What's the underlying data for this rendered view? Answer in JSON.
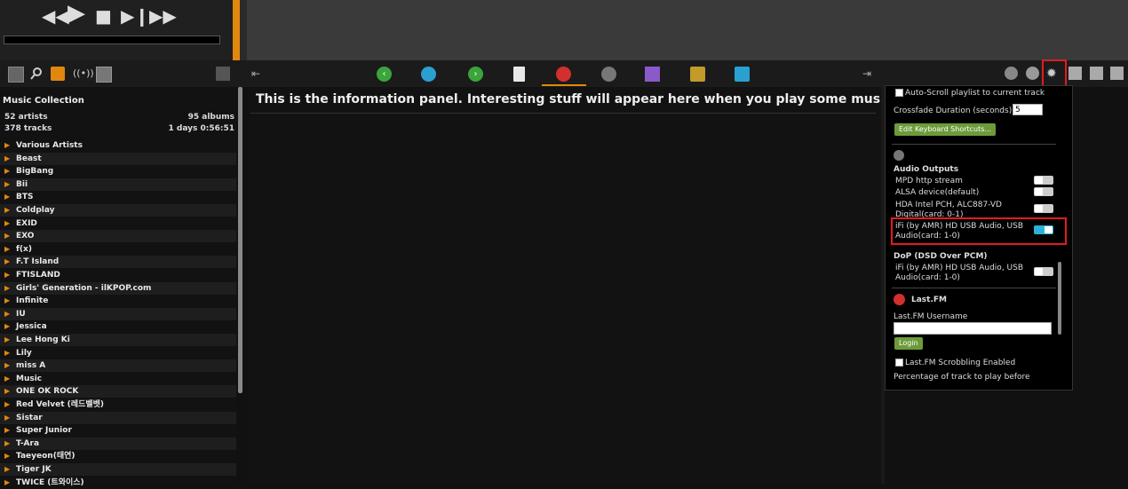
{
  "sidebar": {
    "title": "Music Collection",
    "stats": {
      "artists": "52 artists",
      "albums": "95 albums",
      "tracks": "378 tracks",
      "duration": "1 days 0:56:51"
    },
    "artists": [
      "Various Artists",
      "Beast",
      "BigBang",
      "Bii",
      "BTS",
      "Coldplay",
      "EXID",
      "EXO",
      "f(x)",
      "F.T Island",
      "FTISLAND",
      "Girls' Generation - ilKPOP.com",
      "Infinite",
      "IU",
      "Jessica",
      "Lee Hong Ki",
      "Lily",
      "miss A",
      "Music",
      "ONE OK ROCK",
      "Red Velvet (레드벨벳)",
      "Sistar",
      "Super Junior",
      "T-Ara",
      "Taeyeon(태연)",
      "Tiger JK",
      "TWICE (트와이스)"
    ]
  },
  "main": {
    "info_text": "This is the information panel. Interesting stuff will appear here when you play some music"
  },
  "prefs": {
    "autoscroll_label": "Auto-Scroll playlist to current track",
    "crossfade_label": "Crossfade Duration (seconds)",
    "crossfade_value": "5",
    "keyboard_button": "Edit Keyboard Shortcuts...",
    "audio_outputs_heading": "Audio Outputs",
    "outputs": [
      {
        "label": "MPD http stream",
        "enabled": false
      },
      {
        "label": "ALSA device(default)",
        "enabled": false
      },
      {
        "label_line1": "HDA Intel PCH, ALC887-VD",
        "label_line2": "Digital(card: 0-1)",
        "enabled": false
      },
      {
        "label_line1": "iFi (by AMR) HD USB Audio, USB",
        "label_line2": "Audio(card: 1-0)",
        "enabled": true
      }
    ],
    "dop_heading": "DoP (DSD Over PCM)",
    "dop_line1": "iFi (by AMR) HD USB Audio, USB",
    "dop_line2": "Audio(card: 1-0)",
    "dop_enabled": false,
    "lastfm_heading": "Last.FM",
    "lastfm_username_label": "Last.FM Username",
    "lastfm_username_value": "",
    "login_button": "Login",
    "scrobbling_label": "Last.FM Scrobbling Enabled",
    "percentage_label": "Percentage of track to play before"
  },
  "colors": {
    "accent": "#e0880e",
    "toggle_on": "#2ab3d6",
    "highlight": "#e31c1c",
    "button_green": "#6d9b3a"
  }
}
